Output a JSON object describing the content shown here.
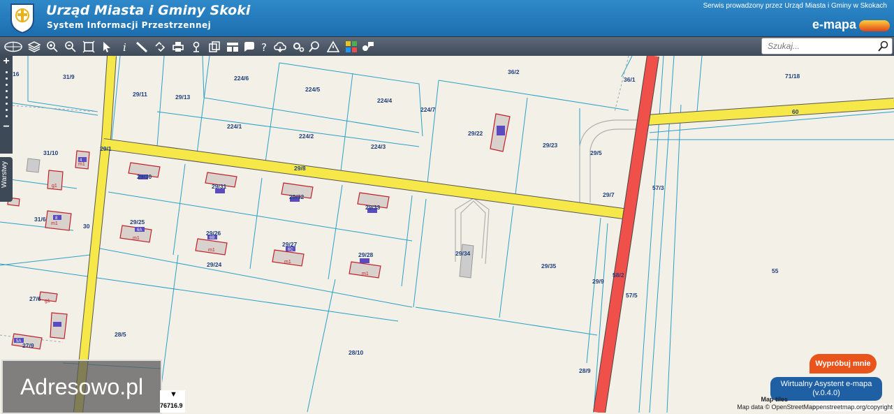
{
  "header": {
    "title": "Urząd Miasta i Gminy Skoki",
    "subtitle": "System Informacji Przestrzennej",
    "operator": "Serwis prowadzony przez Urząd Miasta i Gminy w Skokach",
    "brand": "e-mapa"
  },
  "toolbar": {
    "tools": [
      "globe-icon",
      "layers-icon",
      "zoom-in-icon",
      "zoom-out-icon",
      "zoom-extent-icon",
      "pointer-icon",
      "info-icon",
      "measure-icon",
      "link-icon",
      "print-icon",
      "pin-icon",
      "copy-icon",
      "layout-icon",
      "comment-icon",
      "help-icon",
      "cloud-icon",
      "settings-icon",
      "search-map-icon",
      "warning-icon",
      "grid-icon",
      "chat-icon"
    ]
  },
  "search": {
    "placeholder": "Szukaj..."
  },
  "zoom": {
    "plus": "+",
    "minus": "−"
  },
  "layers_tab": "Warstwy",
  "watermark": "Adresowo.pl",
  "coordinate": "76716.9",
  "buttons": {
    "try_label": "Wypróbuj mnie",
    "assistant_line1": "Wirtualny Asystent e-mapa",
    "assistant_line2": "(v.0.4.0)"
  },
  "attribution": {
    "line1": "Map tiles",
    "line2": "Map data © OpenStreetMap",
    "line3": "openstreetmap.org/copyright"
  },
  "colors": {
    "header": "#1c6eae",
    "toolbar": "#3e4957",
    "road_yellow": "#f7e84a",
    "road_red": "#f0504a",
    "parcel_line": "#2aa0c8"
  },
  "parcels": [
    {
      "id": "p1",
      "text": "16"
    },
    {
      "id": "p2",
      "text": "31/9"
    },
    {
      "id": "p3",
      "text": "29/11"
    },
    {
      "id": "p4",
      "text": "29/13"
    },
    {
      "id": "p5",
      "text": "224/6"
    },
    {
      "id": "p6",
      "text": "224/5"
    },
    {
      "id": "p7",
      "text": "224/4"
    },
    {
      "id": "p8",
      "text": "224/7"
    },
    {
      "id": "p9",
      "text": "36/2"
    },
    {
      "id": "p10",
      "text": "36/1"
    },
    {
      "id": "p11",
      "text": "71/18"
    },
    {
      "id": "p12",
      "text": "60"
    },
    {
      "id": "p13",
      "text": "224/1"
    },
    {
      "id": "p14",
      "text": "224/2"
    },
    {
      "id": "p15",
      "text": "224/3"
    },
    {
      "id": "p16",
      "text": "29/22"
    },
    {
      "id": "p17",
      "text": "29/23"
    },
    {
      "id": "p18",
      "text": "29/5"
    },
    {
      "id": "p19",
      "text": "29/1"
    },
    {
      "id": "p20",
      "text": "31/10"
    },
    {
      "id": "p21",
      "text": "29/8"
    },
    {
      "id": "p22",
      "text": "29/30"
    },
    {
      "id": "p23",
      "text": "29/31"
    },
    {
      "id": "p24",
      "text": "29/32"
    },
    {
      "id": "p25",
      "text": "29/33"
    },
    {
      "id": "p26",
      "text": "29/7"
    },
    {
      "id": "p27",
      "text": "57/3"
    },
    {
      "id": "p28",
      "text": "31/6"
    },
    {
      "id": "p29",
      "text": "30"
    },
    {
      "id": "p30",
      "text": "29/25"
    },
    {
      "id": "p31",
      "text": "29/26"
    },
    {
      "id": "p32",
      "text": "29/27"
    },
    {
      "id": "p33",
      "text": "29/28"
    },
    {
      "id": "p34",
      "text": "29/34"
    },
    {
      "id": "p35",
      "text": "29/35"
    },
    {
      "id": "p36",
      "text": "29/24"
    },
    {
      "id": "p37",
      "text": "29/9"
    },
    {
      "id": "p38",
      "text": "58/2"
    },
    {
      "id": "p39",
      "text": "57/5"
    },
    {
      "id": "p40",
      "text": "55"
    },
    {
      "id": "p41",
      "text": "27/6"
    },
    {
      "id": "p42",
      "text": "28/5"
    },
    {
      "id": "p43",
      "text": "27/9"
    },
    {
      "id": "p44",
      "text": "28/10"
    },
    {
      "id": "p45",
      "text": "28/9"
    }
  ],
  "building_labels": [
    "m1",
    "m1",
    "m1",
    "m1",
    "m1",
    "m1",
    "g1",
    "g1",
    "5A",
    "6A",
    "6B",
    "6C",
    "4",
    "8"
  ]
}
